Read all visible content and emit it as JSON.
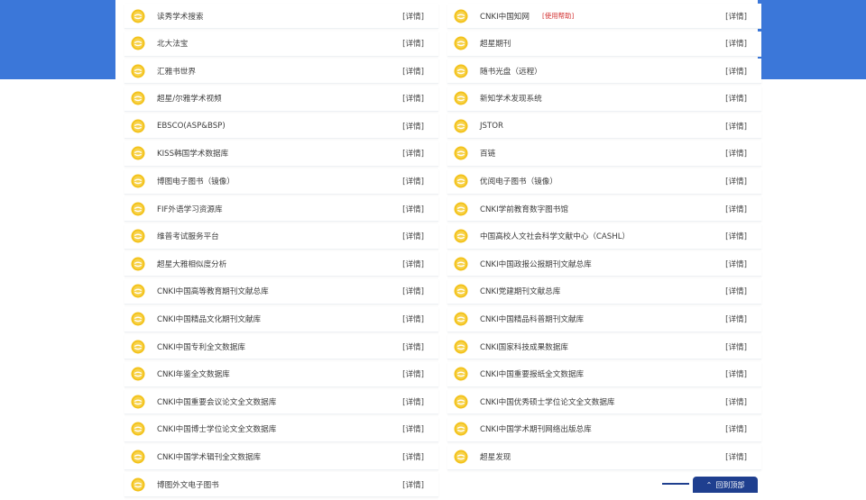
{
  "icon": "coin-db-icon",
  "colors": {
    "header_blue": "#3b77d9",
    "help_red": "#d33434",
    "coin": "#f3c21a"
  },
  "left_items": [
    {
      "name": "读秀学术搜索",
      "detail": "[详情]"
    },
    {
      "name": "北大法宝",
      "detail": "[详情]"
    },
    {
      "name": "汇雅书世界",
      "detail": "[详情]"
    },
    {
      "name": "超星/尔雅学术视频",
      "detail": "[详情]"
    },
    {
      "name": "EBSCO(ASP&BSP)",
      "detail": "[详情]"
    },
    {
      "name": "KISS韩国学术数据库",
      "detail": "[详情]"
    },
    {
      "name": "博图电子图书（镜像）",
      "detail": "[详情]"
    },
    {
      "name": "FIF外语学习资源库",
      "detail": "[详情]"
    },
    {
      "name": "维普考试服务平台",
      "detail": "[详情]"
    },
    {
      "name": "超星大雅相似度分析",
      "detail": "[详情]"
    },
    {
      "name": "CNKI中国高等教育期刊文献总库",
      "detail": "[详情]"
    },
    {
      "name": "CNKI中国精品文化期刊文献库",
      "detail": "[详情]"
    },
    {
      "name": "CNKI中国专利全文数据库",
      "detail": "[详情]"
    },
    {
      "name": "CNKI年鉴全文数据库",
      "detail": "[详情]"
    },
    {
      "name": "CNKI中国重要会议论文全文数据库",
      "detail": "[详情]"
    },
    {
      "name": "CNKI中国博士学位论文全文数据库",
      "detail": "[详情]"
    },
    {
      "name": "CNKI中国学术辑刊全文数据库",
      "detail": "[详情]"
    },
    {
      "name": "博图外文电子图书",
      "detail": "[详情]"
    }
  ],
  "right_items": [
    {
      "name": "CNKI中国知网",
      "help": "[使用帮助]",
      "detail": "[详情]"
    },
    {
      "name": "超星期刊",
      "detail": "[详情]"
    },
    {
      "name": "随书光盘（远程）",
      "detail": "[详情]"
    },
    {
      "name": "新知学术发现系统",
      "detail": "[详情]"
    },
    {
      "name": "JSTOR",
      "detail": "[详情]"
    },
    {
      "name": "百链",
      "detail": "[详情]"
    },
    {
      "name": "优阅电子图书（镜像）",
      "detail": "[详情]"
    },
    {
      "name": "CNKI学前教育数字图书馆",
      "detail": "[详情]"
    },
    {
      "name": "中国高校人文社会科学文献中心（CASHL）",
      "detail": "[详情]"
    },
    {
      "name": "CNKI中国政报公报期刊文献总库",
      "detail": "[详情]"
    },
    {
      "name": "CNKI党建期刊文献总库",
      "detail": "[详情]"
    },
    {
      "name": "CNKI中国精品科普期刊文献库",
      "detail": "[详情]"
    },
    {
      "name": "CNKI国家科技成果数据库",
      "detail": "[详情]"
    },
    {
      "name": "CNKI中国重要报纸全文数据库",
      "detail": "[详情]"
    },
    {
      "name": "CNKI中国优秀硕士学位论文全文数据库",
      "detail": "[详情]"
    },
    {
      "name": "CNKI中国学术期刊网络出版总库",
      "detail": "[详情]"
    },
    {
      "name": "超星发现",
      "detail": "[详情]"
    }
  ],
  "back_to_top": "回到顶部"
}
